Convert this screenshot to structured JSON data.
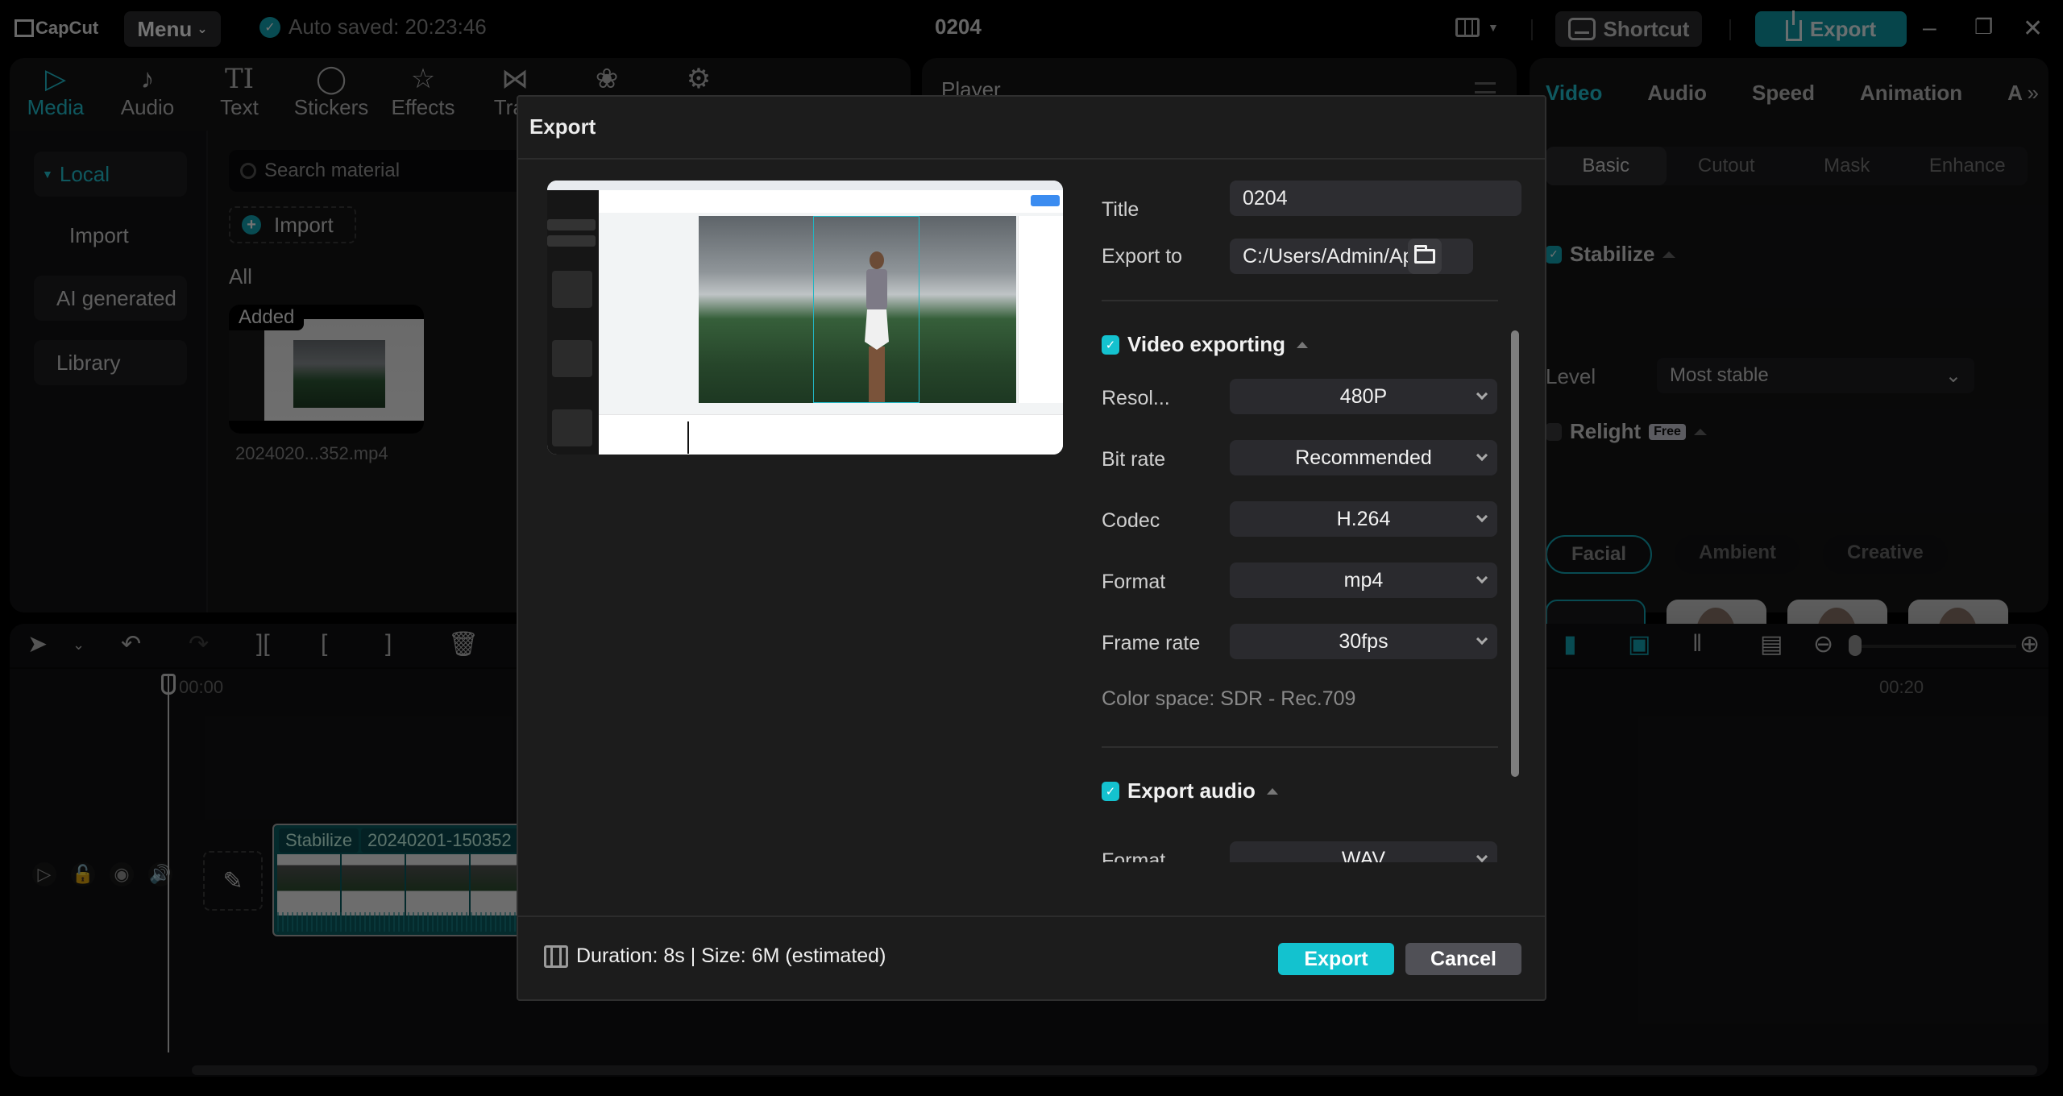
{
  "app": {
    "name": "CapCut",
    "menu_label": "Menu",
    "autosave_text": "Auto saved: 20:23:46",
    "project_title": "0204",
    "shortcut_label": "Shortcut",
    "export_label": "Export",
    "window_controls": [
      "minimize-icon",
      "restore-icon",
      "close-icon"
    ]
  },
  "toolbar": {
    "tabs": [
      {
        "label": "Media",
        "icon": "media-icon",
        "active": true
      },
      {
        "label": "Audio",
        "icon": "audio-icon"
      },
      {
        "label": "Text",
        "icon": "text-icon"
      },
      {
        "label": "Stickers",
        "icon": "stickers-icon"
      },
      {
        "label": "Effects",
        "icon": "effects-icon"
      },
      {
        "label": "Tran",
        "icon": "transitions-icon"
      },
      {
        "label": "",
        "icon": "filters-icon"
      },
      {
        "label": "",
        "icon": "adjustment-icon"
      }
    ]
  },
  "media": {
    "sidebar": [
      {
        "label": "Local",
        "active": true
      },
      {
        "label": "Import"
      },
      {
        "label": "AI generated"
      },
      {
        "label": "Library"
      }
    ],
    "search_placeholder": "Search material",
    "import_label": "Import",
    "filter_label": "All",
    "items": [
      {
        "badge": "Added",
        "file_name": "2024020...352.mp4"
      }
    ]
  },
  "player": {
    "title": "Player"
  },
  "properties": {
    "tabs": [
      "Video",
      "Audio",
      "Speed",
      "Animation",
      "A"
    ],
    "active_tab": "Video",
    "sub_tabs": [
      "Basic",
      "Cutout",
      "Mask",
      "Enhance"
    ],
    "active_sub_tab": "Basic",
    "stabilize": {
      "label": "Stabilize",
      "checked": true,
      "level_label": "Level",
      "level_value": "Most stable"
    },
    "relight": {
      "label": "Relight",
      "badge": "Free",
      "checked": false,
      "categories": [
        "Facial",
        "Ambient",
        "Creative"
      ],
      "active_category": "Facial"
    }
  },
  "timeline": {
    "ruler_labels": [
      "00:00",
      "00:20"
    ],
    "clip": {
      "tag": "Stabilize",
      "name": "20240201-150352"
    }
  },
  "export_dialog": {
    "title": "Export",
    "fields": {
      "title_label": "Title",
      "title_value": "0204",
      "export_to_label": "Export to",
      "export_to_value": "C:/Users/Admin/App..."
    },
    "video_section": {
      "label": "Video exporting",
      "checked": true,
      "settings": [
        {
          "label": "Resol...",
          "value": "480P"
        },
        {
          "label": "Bit rate",
          "value": "Recommended"
        },
        {
          "label": "Codec",
          "value": "H.264"
        },
        {
          "label": "Format",
          "value": "mp4"
        },
        {
          "label": "Frame rate",
          "value": "30fps"
        }
      ],
      "color_space": "Color space: SDR - Rec.709"
    },
    "audio_section": {
      "label": "Export audio",
      "checked": true,
      "settings": [
        {
          "label": "Format",
          "value": "WAV"
        }
      ]
    },
    "footer": {
      "summary": "Duration: 8s | Size: 6M (estimated)",
      "export_label": "Export",
      "cancel_label": "Cancel"
    }
  },
  "colors": {
    "accent": "#13c2cf",
    "dialog_bg": "#1c1c1c",
    "cancel_bg": "#505056"
  }
}
